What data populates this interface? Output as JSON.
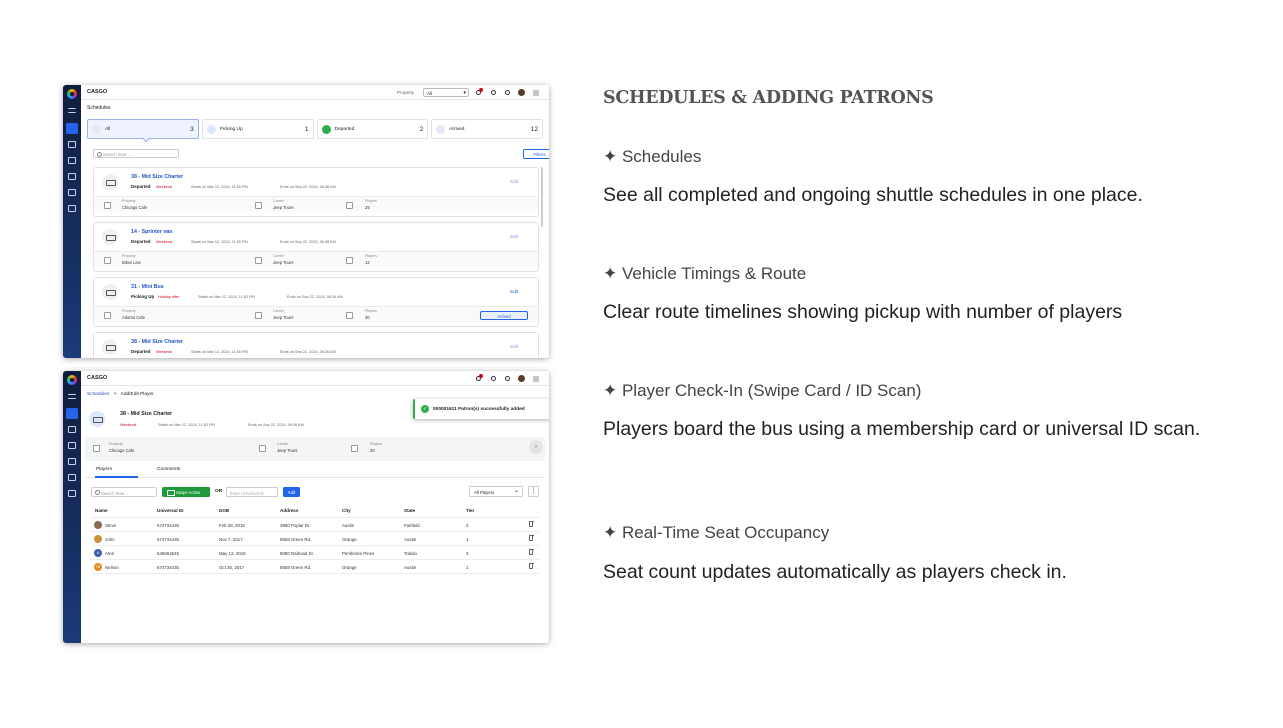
{
  "right": {
    "heading": "SCHEDULES & ADDING PATRONS",
    "sections": [
      {
        "title": "✦ Schedules",
        "desc": "See all completed and ongoing shuttle schedules in one place."
      },
      {
        "title": "✦ Vehicle Timings & Route",
        "desc": "Clear route timelines showing pickup with number of players"
      },
      {
        "title": "✦ Player Check-In (Swipe Card / ID Scan)",
        "desc": "Players board the bus using a membership card or universal ID scan."
      },
      {
        "title": "✦ Real-Time Seat Occupancy",
        "desc": "Seat count updates automatically as players check in."
      }
    ]
  },
  "shot1": {
    "brand": "CASGO",
    "property_label": "Property",
    "property_value": "All",
    "page_title": "Schedules",
    "cards": [
      {
        "label": "All",
        "count": "3"
      },
      {
        "label": "Picking Up",
        "count": "1"
      },
      {
        "label": "Departed",
        "count": "2"
      },
      {
        "label": "Arrived",
        "count": "12"
      }
    ],
    "search_placeholder": "Search here...",
    "filters": "Filters",
    "schedules": [
      {
        "name": "38 - Mid Size Charter",
        "status": "Departed",
        "tag": "Weekend",
        "start": "Starts on Mar 12, 2024, 11:50 PM",
        "end": "Ends on Sep 22, 2024, 06:36 AM",
        "edit": "Edit",
        "property_label": "Property",
        "property": "Chicago Cafe",
        "carrier_label": "Carrier",
        "carrier": "Jeep Tours",
        "players_label": "Players",
        "players": "25"
      },
      {
        "name": "14 - Sprinter van",
        "status": "Departed",
        "tag": "Weekend",
        "start": "Starts on Mar 12, 2024, 11:50 PM",
        "end": "Ends on Sep 22, 2024, 06:36 AM",
        "edit": "Edit",
        "property_label": "Property",
        "property": "Biloxi Live",
        "carrier_label": "Carrier",
        "carrier": "Jeep Tours",
        "players_label": "Players",
        "players": "12"
      },
      {
        "name": "31 - Mini Bus",
        "status": "Picking Up",
        "tag": "Holiday offer",
        "start": "Starts on Mar 12, 2024, 11:50 PM",
        "end": "Ends on Sep 22, 2024, 06:36 AM",
        "edit": "Edit",
        "property_label": "Property",
        "property": "Atlanta Cafe",
        "carrier_label": "Carrier",
        "carrier": "Jeep Tours",
        "players_label": "Players",
        "players": "30",
        "arrived": "Arrived"
      },
      {
        "name": "38 - Mid Size Charter",
        "status": "Departed",
        "tag": "Weekend",
        "start": "Starts on Mar 12, 2024, 11:50 PM",
        "end": "Ends on Sep 22, 2024, 06:36 AM",
        "edit": "Edit"
      }
    ]
  },
  "shot2": {
    "brand": "CASGO",
    "crumb_root": "Schedules",
    "crumb_sep": ">",
    "crumb_current": "Add/Edit Player",
    "vehicle": "38 - Mid Size Charter",
    "tag": "Weekend",
    "start": "Starts on Mar 12, 2024, 11:50 PM",
    "end": "Ends on Sep 22, 2024, 06:36 AM",
    "property_label": "Property",
    "property": "Chicago Cafe",
    "carrier_label": "Carrier",
    "carrier": "Jeep Tours",
    "players_label": "Players",
    "players": "20",
    "next": "›",
    "toast": "000001611 Patron(s) successfully added",
    "toast_close": "✕",
    "tabs": [
      "Players",
      "Comments"
    ],
    "search_placeholder": "Search here...",
    "swipe": "Swipe Active",
    "or": "OR",
    "uid_placeholder": "Enter Universal ID",
    "add": "Add",
    "filter": "All Players",
    "more": "⋮",
    "columns": [
      "Name",
      "Universal ID",
      "DOB",
      "Address",
      "City",
      "State",
      "Tier"
    ],
    "rows": [
      {
        "name": "Steve",
        "uid": "674734435",
        "dob": "Feb 28, 2018",
        "address": "3890 Poplar Dr.",
        "city": "Austin",
        "state": "Fairfield",
        "tier": "2",
        "avatar": "#8a6a55"
      },
      {
        "name": "John",
        "uid": "674734435",
        "dob": "Nov 7, 2017",
        "address": "8558 Green Rd.",
        "city": "Orange",
        "state": "Austin",
        "tier": "1",
        "avatar": "#c8913a"
      },
      {
        "name": "Amit",
        "uid": "546564545",
        "dob": "May 12, 2019",
        "address": "8080 Railroad St.",
        "city": "Pembroke Pines",
        "state": "Toledo",
        "tier": "3",
        "avatar": "#3d5fb0",
        "initial": "A"
      },
      {
        "name": "Nelson",
        "uid": "674734435",
        "dob": "Oct 30, 2017",
        "address": "8558 Green Rd.",
        "city": "Orange",
        "state": "Austin",
        "tier": "1",
        "avatar": "#e08a1e",
        "initial": "TN"
      }
    ]
  }
}
